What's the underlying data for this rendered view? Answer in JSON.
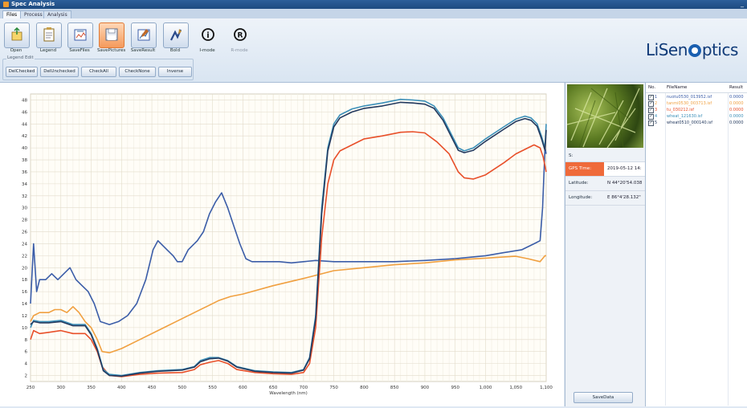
{
  "window": {
    "title": "Spec Analysis",
    "controls": "_"
  },
  "tabs": [
    {
      "label": "Files",
      "active": true
    },
    {
      "label": "Process",
      "active": false
    },
    {
      "label": "Analysis",
      "active": false
    }
  ],
  "toolbar": {
    "buttons": [
      {
        "label": "Open",
        "icon": "open-icon"
      },
      {
        "label": "Legend",
        "icon": "legend-icon"
      },
      {
        "label": "SaveFiles",
        "icon": "save-files-icon"
      },
      {
        "label": "SavePictures",
        "icon": "save-pictures-icon",
        "highlighted": true
      },
      {
        "label": "SaveResult",
        "icon": "save-result-icon"
      },
      {
        "label": "Bold",
        "icon": "bold-icon"
      },
      {
        "label": "I-mode",
        "icon": "info-icon"
      },
      {
        "label": "R-mode",
        "icon": "registered-icon",
        "disabled": true
      }
    ],
    "legend_edit": {
      "title": "Legend Edit",
      "buttons": [
        "DelChecked",
        "DelUnchecked",
        "CheckAll",
        "CheckNone",
        "Inverse"
      ]
    }
  },
  "brand": {
    "before": "LiSen",
    "after": "ptics",
    "color": "#0f3a78"
  },
  "gps": {
    "header": "S:",
    "rows": [
      {
        "key": "GPS Time:",
        "value": "2019-05-12 14:"
      },
      {
        "key": "Latitude:",
        "value": "N 44°20'54.038"
      },
      {
        "key": "Longitude:",
        "value": "E 86°4'28.132\""
      }
    ],
    "save_label": "SaveData"
  },
  "file_list": {
    "headers": [
      "No.",
      "FileName",
      "Result"
    ],
    "rows": [
      {
        "no": "1",
        "name": "nuotu0530_013952.isf",
        "result": "0.0000",
        "color": "#3b5da8",
        "checked": true
      },
      {
        "no": "2",
        "name": "tanmi0530_003713.isf",
        "result": "0.0000",
        "color": "#f0a040",
        "checked": true
      },
      {
        "no": "3",
        "name": "tu_030212.isf",
        "result": "0.0000",
        "color": "#e8502a",
        "checked": true
      },
      {
        "no": "4",
        "name": "wheat_121630.isf",
        "result": "0.0000",
        "color": "#3b8fb8",
        "checked": true
      },
      {
        "no": "5",
        "name": "wheat0510_000140.isf",
        "result": "0.0000",
        "color": "#23395e",
        "checked": true
      }
    ]
  },
  "chart_data": {
    "type": "line",
    "xlabel": "Wavelength (nm)",
    "ylabel": "",
    "xlim": [
      250,
      1100
    ],
    "ylim": [
      1,
      49
    ],
    "x_ticks": [
      "250",
      "300",
      "350",
      "400",
      "450",
      "500",
      "550",
      "600",
      "650",
      "700",
      "750",
      "800",
      "850",
      "900",
      "950",
      "1,000",
      "1,050",
      "1,100"
    ],
    "y_ticks": [
      "2",
      "4",
      "6",
      "8",
      "10",
      "12",
      "14",
      "16",
      "18",
      "20",
      "22",
      "24",
      "26",
      "28",
      "30",
      "32",
      "34",
      "36",
      "38",
      "40",
      "42",
      "44",
      "46",
      "48"
    ],
    "grid": true,
    "series": [
      {
        "color": "#3b5da8",
        "points": [
          [
            250,
            14
          ],
          [
            255,
            24
          ],
          [
            260,
            16
          ],
          [
            265,
            18
          ],
          [
            275,
            18
          ],
          [
            285,
            19
          ],
          [
            295,
            18
          ],
          [
            305,
            19
          ],
          [
            315,
            20
          ],
          [
            325,
            18
          ],
          [
            335,
            17
          ],
          [
            345,
            16
          ],
          [
            355,
            14
          ],
          [
            365,
            11
          ],
          [
            380,
            10.5
          ],
          [
            395,
            11
          ],
          [
            410,
            12
          ],
          [
            425,
            14
          ],
          [
            440,
            18
          ],
          [
            452,
            23
          ],
          [
            460,
            24.5
          ],
          [
            475,
            23
          ],
          [
            485,
            22
          ],
          [
            492,
            21
          ],
          [
            500,
            21
          ],
          [
            510,
            23
          ],
          [
            525,
            24.5
          ],
          [
            535,
            26
          ],
          [
            545,
            29
          ],
          [
            555,
            31
          ],
          [
            565,
            32.5
          ],
          [
            575,
            30
          ],
          [
            585,
            27
          ],
          [
            595,
            24
          ],
          [
            605,
            21.5
          ],
          [
            615,
            21
          ],
          [
            640,
            21
          ],
          [
            660,
            21
          ],
          [
            680,
            20.8
          ],
          [
            700,
            21
          ],
          [
            720,
            21.2
          ],
          [
            750,
            21
          ],
          [
            800,
            21
          ],
          [
            850,
            21
          ],
          [
            900,
            21.2
          ],
          [
            950,
            21.5
          ],
          [
            1000,
            22
          ],
          [
            1030,
            22.5
          ],
          [
            1060,
            23
          ],
          [
            1080,
            24
          ],
          [
            1090,
            24.5
          ],
          [
            1094,
            30
          ],
          [
            1096,
            35
          ],
          [
            1098,
            40
          ],
          [
            1100,
            39
          ]
        ]
      },
      {
        "color": "#f0a040",
        "points": [
          [
            250,
            11
          ],
          [
            255,
            12
          ],
          [
            265,
            12.5
          ],
          [
            280,
            12.5
          ],
          [
            290,
            13
          ],
          [
            300,
            13
          ],
          [
            310,
            12.5
          ],
          [
            320,
            13.5
          ],
          [
            330,
            12.5
          ],
          [
            340,
            11
          ],
          [
            350,
            10
          ],
          [
            360,
            8
          ],
          [
            368,
            6
          ],
          [
            380,
            5.8
          ],
          [
            400,
            6.5
          ],
          [
            430,
            8
          ],
          [
            460,
            9.5
          ],
          [
            500,
            11.5
          ],
          [
            540,
            13.5
          ],
          [
            560,
            14.5
          ],
          [
            580,
            15.2
          ],
          [
            600,
            15.6
          ],
          [
            650,
            17
          ],
          [
            700,
            18.2
          ],
          [
            750,
            19.5
          ],
          [
            800,
            20
          ],
          [
            850,
            20.5
          ],
          [
            900,
            20.8
          ],
          [
            950,
            21.3
          ],
          [
            1000,
            21.6
          ],
          [
            1030,
            21.8
          ],
          [
            1050,
            21.9
          ],
          [
            1070,
            21.5
          ],
          [
            1090,
            21
          ],
          [
            1098,
            22
          ],
          [
            1100,
            22
          ]
        ]
      },
      {
        "color": "#e8502a",
        "points": [
          [
            250,
            8
          ],
          [
            255,
            9.5
          ],
          [
            265,
            9
          ],
          [
            280,
            9.2
          ],
          [
            300,
            9.5
          ],
          [
            320,
            9
          ],
          [
            340,
            9
          ],
          [
            350,
            8
          ],
          [
            360,
            6
          ],
          [
            368,
            3.5
          ],
          [
            380,
            2
          ],
          [
            400,
            1.8
          ],
          [
            430,
            2.2
          ],
          [
            460,
            2.4
          ],
          [
            500,
            2.5
          ],
          [
            520,
            3
          ],
          [
            530,
            3.8
          ],
          [
            545,
            4.2
          ],
          [
            560,
            4.5
          ],
          [
            575,
            4
          ],
          [
            590,
            3
          ],
          [
            620,
            2.5
          ],
          [
            650,
            2.3
          ],
          [
            680,
            2.2
          ],
          [
            700,
            2.5
          ],
          [
            710,
            4
          ],
          [
            720,
            10
          ],
          [
            730,
            25
          ],
          [
            740,
            34
          ],
          [
            750,
            38
          ],
          [
            760,
            39.5
          ],
          [
            780,
            40.5
          ],
          [
            800,
            41.5
          ],
          [
            830,
            42
          ],
          [
            860,
            42.6
          ],
          [
            880,
            42.7
          ],
          [
            900,
            42.5
          ],
          [
            920,
            41
          ],
          [
            940,
            39
          ],
          [
            945,
            38
          ],
          [
            955,
            36
          ],
          [
            965,
            35
          ],
          [
            980,
            34.8
          ],
          [
            1000,
            35.5
          ],
          [
            1030,
            37.5
          ],
          [
            1050,
            39
          ],
          [
            1070,
            40
          ],
          [
            1080,
            40.5
          ],
          [
            1090,
            40
          ],
          [
            1095,
            38.5
          ],
          [
            1100,
            36
          ]
        ]
      },
      {
        "color": "#3b8fb8",
        "points": [
          [
            250,
            10
          ],
          [
            255,
            11.2
          ],
          [
            265,
            11
          ],
          [
            280,
            11
          ],
          [
            300,
            11.2
          ],
          [
            320,
            10.5
          ],
          [
            340,
            10.5
          ],
          [
            350,
            9
          ],
          [
            360,
            6.5
          ],
          [
            370,
            3
          ],
          [
            380,
            2.2
          ],
          [
            400,
            2
          ],
          [
            430,
            2.5
          ],
          [
            460,
            2.8
          ],
          [
            500,
            3
          ],
          [
            520,
            3.5
          ],
          [
            530,
            4.5
          ],
          [
            545,
            5
          ],
          [
            560,
            5
          ],
          [
            575,
            4.5
          ],
          [
            590,
            3.5
          ],
          [
            620,
            2.8
          ],
          [
            650,
            2.6
          ],
          [
            680,
            2.5
          ],
          [
            700,
            3
          ],
          [
            710,
            5
          ],
          [
            720,
            12
          ],
          [
            730,
            30
          ],
          [
            740,
            40
          ],
          [
            750,
            44
          ],
          [
            760,
            45.5
          ],
          [
            780,
            46.5
          ],
          [
            800,
            47
          ],
          [
            830,
            47.5
          ],
          [
            860,
            48.1
          ],
          [
            880,
            48
          ],
          [
            900,
            47.8
          ],
          [
            915,
            47
          ],
          [
            930,
            45
          ],
          [
            945,
            42
          ],
          [
            955,
            40
          ],
          [
            965,
            39.5
          ],
          [
            980,
            40
          ],
          [
            1000,
            41.5
          ],
          [
            1030,
            43.5
          ],
          [
            1050,
            44.8
          ],
          [
            1065,
            45.3
          ],
          [
            1075,
            45
          ],
          [
            1085,
            44
          ],
          [
            1092,
            42
          ],
          [
            1098,
            40
          ],
          [
            1100,
            44
          ]
        ]
      },
      {
        "color": "#23395e",
        "points": [
          [
            250,
            10.5
          ],
          [
            255,
            11
          ],
          [
            265,
            10.8
          ],
          [
            280,
            10.8
          ],
          [
            300,
            11
          ],
          [
            320,
            10.3
          ],
          [
            340,
            10.3
          ],
          [
            350,
            8.8
          ],
          [
            360,
            6.3
          ],
          [
            370,
            2.8
          ],
          [
            380,
            2
          ],
          [
            400,
            1.9
          ],
          [
            430,
            2.4
          ],
          [
            460,
            2.7
          ],
          [
            500,
            2.9
          ],
          [
            520,
            3.4
          ],
          [
            530,
            4.3
          ],
          [
            545,
            4.8
          ],
          [
            560,
            4.9
          ],
          [
            575,
            4.4
          ],
          [
            590,
            3.4
          ],
          [
            620,
            2.7
          ],
          [
            650,
            2.5
          ],
          [
            680,
            2.4
          ],
          [
            700,
            2.9
          ],
          [
            710,
            4.8
          ],
          [
            720,
            11.5
          ],
          [
            730,
            29
          ],
          [
            740,
            39.5
          ],
          [
            750,
            43.5
          ],
          [
            760,
            45
          ],
          [
            780,
            46
          ],
          [
            800,
            46.6
          ],
          [
            830,
            47
          ],
          [
            860,
            47.6
          ],
          [
            880,
            47.5
          ],
          [
            900,
            47.3
          ],
          [
            915,
            46.6
          ],
          [
            930,
            44.6
          ],
          [
            945,
            41.6
          ],
          [
            955,
            39.6
          ],
          [
            965,
            39.2
          ],
          [
            980,
            39.6
          ],
          [
            1000,
            41.1
          ],
          [
            1030,
            43.1
          ],
          [
            1050,
            44.4
          ],
          [
            1065,
            44.9
          ],
          [
            1075,
            44.6
          ],
          [
            1085,
            43.6
          ],
          [
            1092,
            41.6
          ],
          [
            1098,
            39.6
          ],
          [
            1100,
            43
          ]
        ]
      }
    ]
  }
}
